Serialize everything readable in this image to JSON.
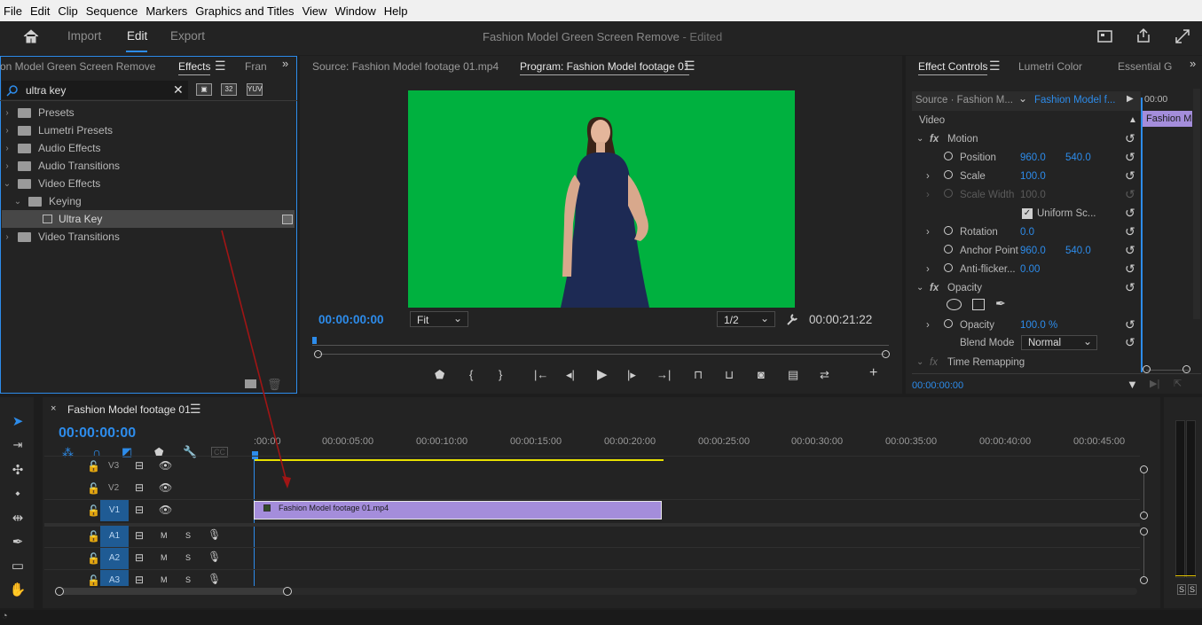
{
  "menu": [
    "File",
    "Edit",
    "Clip",
    "Sequence",
    "Markers",
    "Graphics and Titles",
    "View",
    "Window",
    "Help"
  ],
  "workspaces": {
    "home": "home-icon",
    "import": "Import",
    "edit": "Edit",
    "export": "Export"
  },
  "project_title": {
    "name": "Fashion Model Green Screen Remove",
    "status": "- Edited"
  },
  "effects_panel": {
    "tab_project": "on Model Green Screen Remove",
    "tab_effects": "Effects",
    "tab_more": "Fran",
    "search_value": "ultra key",
    "badges": [
      "32",
      "YUV"
    ],
    "tree": [
      "Presets",
      "Lumetri Presets",
      "Audio Effects",
      "Audio Transitions",
      "Video Effects",
      "Keying",
      "Ultra Key",
      "Video Transitions"
    ]
  },
  "program_monitor": {
    "source_tab": "Source: Fashion Model footage 01.mp4",
    "program_tab": "Program: Fashion Model footage 01",
    "timecode_in": "00:00:00:00",
    "fit": "Fit",
    "resolution": "1/2",
    "timecode_dur": "00:00:21:22",
    "green_color": "#00b13f"
  },
  "effect_controls": {
    "tabs": [
      "Effect Controls",
      "Lumetri Color",
      "Essential Gr"
    ],
    "source": "Source · Fashion M...",
    "clip": "Fashion Model f...",
    "timeline_time": "00:00",
    "clip_chip": "Fashion M",
    "video_label": "Video",
    "motion": "Motion",
    "position": {
      "label": "Position",
      "x": "960.0",
      "y": "540.0"
    },
    "scale": {
      "label": "Scale",
      "value": "100.0"
    },
    "scale_width": {
      "label": "Scale Width",
      "value": "100.0"
    },
    "uniform": "Uniform Sc...",
    "rotation": {
      "label": "Rotation",
      "value": "0.0"
    },
    "anchor": {
      "label": "Anchor Point",
      "x": "960.0",
      "y": "540.0"
    },
    "antiflicker": {
      "label": "Anti-flicker...",
      "value": "0.00"
    },
    "opacity_group": "Opacity",
    "opacity": {
      "label": "Opacity",
      "value": "100.0 %"
    },
    "blend": {
      "label": "Blend Mode",
      "value": "Normal"
    },
    "time_remap": "Time Remapping",
    "footer_time": "00:00:00:00"
  },
  "timeline": {
    "sequence_tab": "Fashion Model footage 01",
    "timecode": "00:00:00:00",
    "ruler": [
      ":00:00",
      "00:00:05:00",
      "00:00:10:00",
      "00:00:15:00",
      "00:00:20:00",
      "00:00:25:00",
      "00:00:30:00",
      "00:00:35:00",
      "00:00:40:00",
      "00:00:45:00"
    ],
    "tracks": [
      "V3",
      "V2",
      "V1",
      "A1",
      "A2",
      "A3"
    ],
    "clip_label": "Fashion Model footage 01.mp4",
    "clip_color": "#a48ddb",
    "meter_labels": [
      "S",
      "S"
    ]
  }
}
